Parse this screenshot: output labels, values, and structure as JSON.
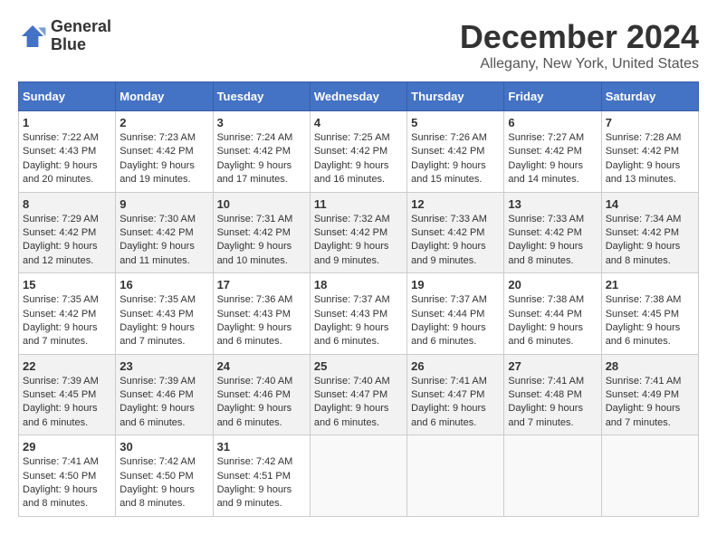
{
  "header": {
    "logo_line1": "General",
    "logo_line2": "Blue",
    "title": "December 2024",
    "location": "Allegany, New York, United States"
  },
  "weekdays": [
    "Sunday",
    "Monday",
    "Tuesday",
    "Wednesday",
    "Thursday",
    "Friday",
    "Saturday"
  ],
  "weeks": [
    [
      {
        "day": "1",
        "sunrise": "7:22 AM",
        "sunset": "4:43 PM",
        "daylight": "9 hours and 20 minutes."
      },
      {
        "day": "2",
        "sunrise": "7:23 AM",
        "sunset": "4:42 PM",
        "daylight": "9 hours and 19 minutes."
      },
      {
        "day": "3",
        "sunrise": "7:24 AM",
        "sunset": "4:42 PM",
        "daylight": "9 hours and 17 minutes."
      },
      {
        "day": "4",
        "sunrise": "7:25 AM",
        "sunset": "4:42 PM",
        "daylight": "9 hours and 16 minutes."
      },
      {
        "day": "5",
        "sunrise": "7:26 AM",
        "sunset": "4:42 PM",
        "daylight": "9 hours and 15 minutes."
      },
      {
        "day": "6",
        "sunrise": "7:27 AM",
        "sunset": "4:42 PM",
        "daylight": "9 hours and 14 minutes."
      },
      {
        "day": "7",
        "sunrise": "7:28 AM",
        "sunset": "4:42 PM",
        "daylight": "9 hours and 13 minutes."
      }
    ],
    [
      {
        "day": "8",
        "sunrise": "7:29 AM",
        "sunset": "4:42 PM",
        "daylight": "9 hours and 12 minutes."
      },
      {
        "day": "9",
        "sunrise": "7:30 AM",
        "sunset": "4:42 PM",
        "daylight": "9 hours and 11 minutes."
      },
      {
        "day": "10",
        "sunrise": "7:31 AM",
        "sunset": "4:42 PM",
        "daylight": "9 hours and 10 minutes."
      },
      {
        "day": "11",
        "sunrise": "7:32 AM",
        "sunset": "4:42 PM",
        "daylight": "9 hours and 9 minutes."
      },
      {
        "day": "12",
        "sunrise": "7:33 AM",
        "sunset": "4:42 PM",
        "daylight": "9 hours and 9 minutes."
      },
      {
        "day": "13",
        "sunrise": "7:33 AM",
        "sunset": "4:42 PM",
        "daylight": "9 hours and 8 minutes."
      },
      {
        "day": "14",
        "sunrise": "7:34 AM",
        "sunset": "4:42 PM",
        "daylight": "9 hours and 8 minutes."
      }
    ],
    [
      {
        "day": "15",
        "sunrise": "7:35 AM",
        "sunset": "4:42 PM",
        "daylight": "9 hours and 7 minutes."
      },
      {
        "day": "16",
        "sunrise": "7:35 AM",
        "sunset": "4:43 PM",
        "daylight": "9 hours and 7 minutes."
      },
      {
        "day": "17",
        "sunrise": "7:36 AM",
        "sunset": "4:43 PM",
        "daylight": "9 hours and 6 minutes."
      },
      {
        "day": "18",
        "sunrise": "7:37 AM",
        "sunset": "4:43 PM",
        "daylight": "9 hours and 6 minutes."
      },
      {
        "day": "19",
        "sunrise": "7:37 AM",
        "sunset": "4:44 PM",
        "daylight": "9 hours and 6 minutes."
      },
      {
        "day": "20",
        "sunrise": "7:38 AM",
        "sunset": "4:44 PM",
        "daylight": "9 hours and 6 minutes."
      },
      {
        "day": "21",
        "sunrise": "7:38 AM",
        "sunset": "4:45 PM",
        "daylight": "9 hours and 6 minutes."
      }
    ],
    [
      {
        "day": "22",
        "sunrise": "7:39 AM",
        "sunset": "4:45 PM",
        "daylight": "9 hours and 6 minutes."
      },
      {
        "day": "23",
        "sunrise": "7:39 AM",
        "sunset": "4:46 PM",
        "daylight": "9 hours and 6 minutes."
      },
      {
        "day": "24",
        "sunrise": "7:40 AM",
        "sunset": "4:46 PM",
        "daylight": "9 hours and 6 minutes."
      },
      {
        "day": "25",
        "sunrise": "7:40 AM",
        "sunset": "4:47 PM",
        "daylight": "9 hours and 6 minutes."
      },
      {
        "day": "26",
        "sunrise": "7:41 AM",
        "sunset": "4:47 PM",
        "daylight": "9 hours and 6 minutes."
      },
      {
        "day": "27",
        "sunrise": "7:41 AM",
        "sunset": "4:48 PM",
        "daylight": "9 hours and 7 minutes."
      },
      {
        "day": "28",
        "sunrise": "7:41 AM",
        "sunset": "4:49 PM",
        "daylight": "9 hours and 7 minutes."
      }
    ],
    [
      {
        "day": "29",
        "sunrise": "7:41 AM",
        "sunset": "4:50 PM",
        "daylight": "9 hours and 8 minutes."
      },
      {
        "day": "30",
        "sunrise": "7:42 AM",
        "sunset": "4:50 PM",
        "daylight": "9 hours and 8 minutes."
      },
      {
        "day": "31",
        "sunrise": "7:42 AM",
        "sunset": "4:51 PM",
        "daylight": "9 hours and 9 minutes."
      },
      null,
      null,
      null,
      null
    ]
  ],
  "labels": {
    "sunrise": "Sunrise:",
    "sunset": "Sunset:",
    "daylight": "Daylight:"
  }
}
